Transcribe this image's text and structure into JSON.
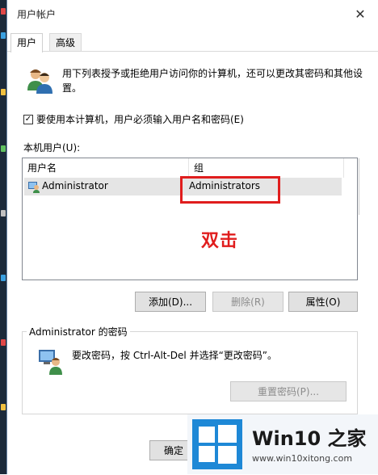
{
  "window": {
    "title": "用户帐户",
    "close_glyph": "✕"
  },
  "tabs": [
    {
      "label": "用户",
      "active": true
    },
    {
      "label": "高级",
      "active": false
    }
  ],
  "intro": "用下列表授予或拒绝用户访问你的计算机，还可以更改其密码和其他设置。",
  "require_login": {
    "label": "要使用本计算机，用户必须输入用户名和密码(E)",
    "checked": true,
    "check_glyph": "✓"
  },
  "local_users_label": "本机用户(U):",
  "user_list": {
    "columns": [
      "用户名",
      "组"
    ],
    "rows": [
      {
        "name": "Administrator",
        "group": "Administrators"
      }
    ]
  },
  "annotation": "双击",
  "buttons": {
    "add": "添加(D)...",
    "remove": "删除(R)",
    "properties": "属性(O)"
  },
  "password_group": {
    "title": "Administrator 的密码",
    "text": "要改密码，按 Ctrl-Alt-Del 并选择“更改密码”。",
    "reset_button": "重置密码(P)..."
  },
  "ok_button": "确定",
  "branding": {
    "title": "Win10 之家",
    "url": "www.win10xitong.com"
  },
  "colors": {
    "highlight": "#e01d1d",
    "selection": "#e5e5e5"
  }
}
